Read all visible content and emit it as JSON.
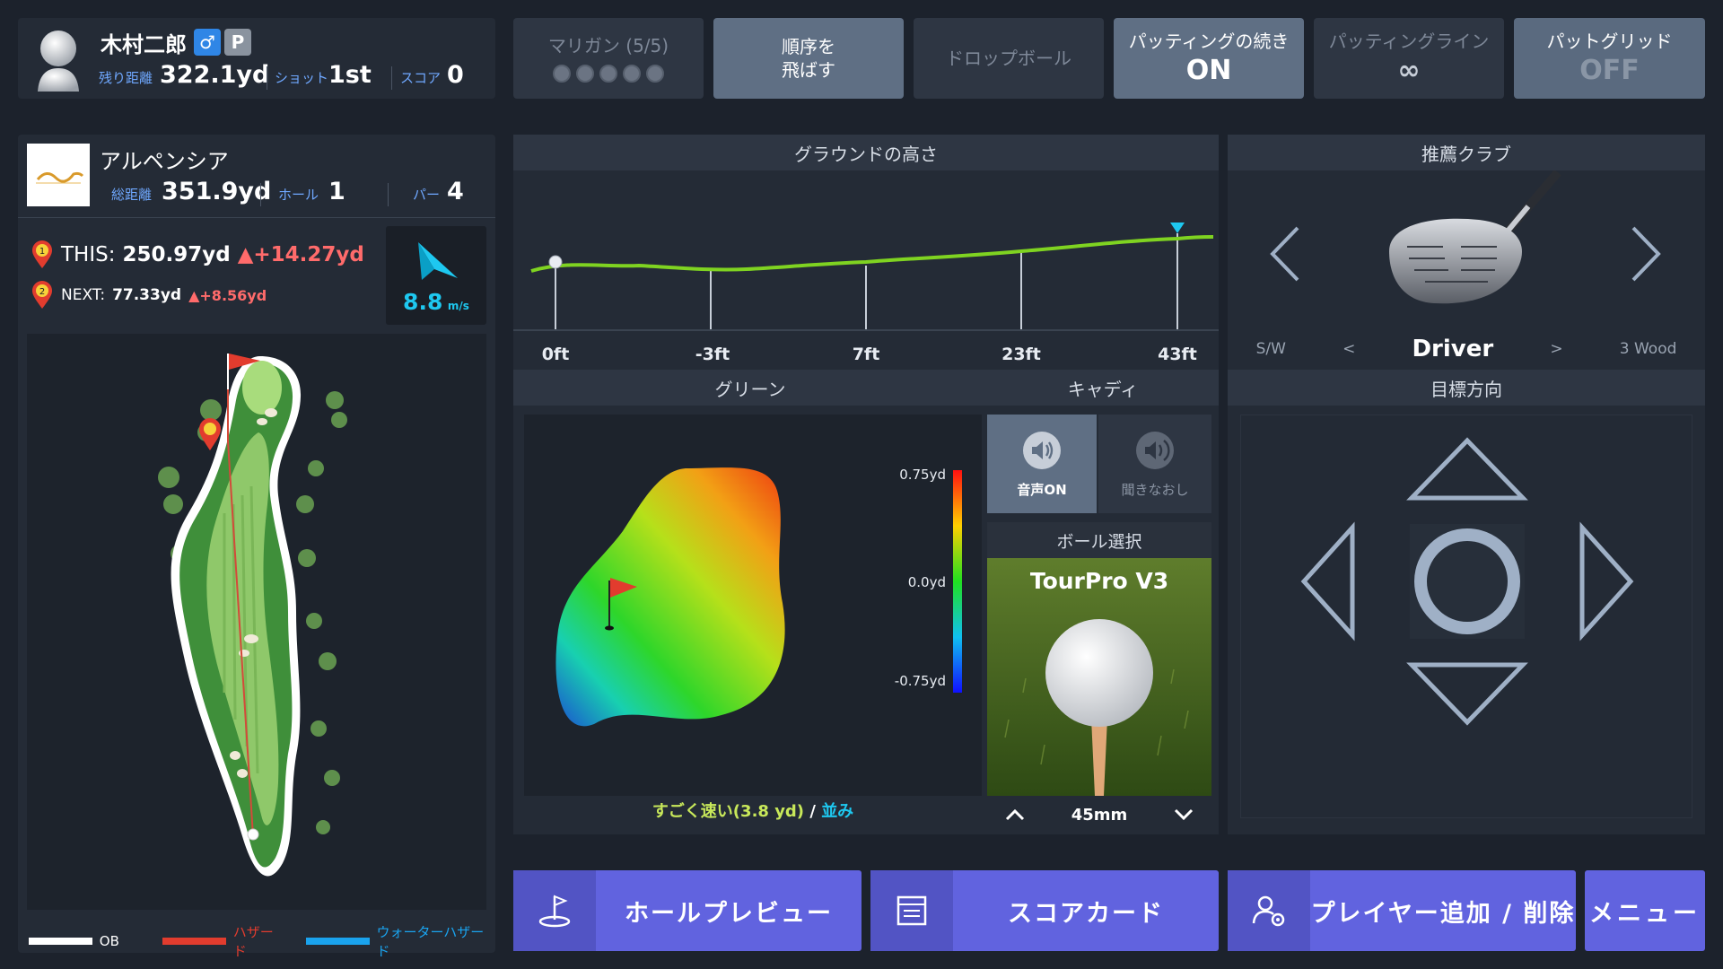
{
  "player": {
    "name": "木村二郎",
    "badge_gender": "♂",
    "badge_p": "P",
    "remaining_label": "残り距離",
    "remaining_value": "322.1yd",
    "shot_label": "ショット",
    "shot_value": "1st",
    "score_label": "スコア",
    "score_value": "0"
  },
  "top_buttons": {
    "mulligan_label": "マリガン (5/5)",
    "skip_line1": "順序を",
    "skip_line2": "飛ばす",
    "drop_label": "ドロップボール",
    "putting_cont_label": "パッティングの続き",
    "putting_cont_value": "ON",
    "putting_line_label": "パッティングライン",
    "putting_line_value": "∞",
    "put_grid_label": "パットグリッド",
    "put_grid_value": "OFF"
  },
  "course": {
    "name": "アルペンシア",
    "total_label": "総距離",
    "total_value": "351.9yd",
    "hole_label": "ホール",
    "hole_value": "1",
    "par_label": "パー",
    "par_value": "4",
    "this_label": "THIS:",
    "this_value": "250.97yd",
    "this_delta": "▲+14.27yd",
    "next_label": "NEXT:",
    "next_value": "77.33yd",
    "next_delta": "▲+8.56yd",
    "wind_value": "8.8",
    "wind_unit": "m/s",
    "marker_1": "1",
    "marker_2": "2",
    "legend_ob": "OB",
    "legend_hazard": "ハザード",
    "legend_water": "ウォーターハザード"
  },
  "ground": {
    "title": "グラウンドの高さ",
    "ticks": [
      "0ft",
      "-3ft",
      "7ft",
      "23ft",
      "43ft"
    ]
  },
  "green": {
    "title": "グリーン",
    "scale_top": "0.75yd",
    "scale_mid": "0.0yd",
    "scale_bottom": "-0.75yd",
    "speed_text": "すごく速い(3.8 yd)",
    "speed_sep": "/",
    "grass_text": "並み"
  },
  "caddie": {
    "title": "キャディ",
    "voice_on": "音声ON",
    "listen_again": "聞きなおし",
    "ball_title": "ボール選択",
    "ball_name": "TourPro V3",
    "tee_height": "45mm"
  },
  "club": {
    "title": "推薦クラブ",
    "prev": "S/W",
    "lt": "<",
    "current": "Driver",
    "gt": ">",
    "next": "3 Wood"
  },
  "aim": {
    "title": "目標方向"
  },
  "bottom": {
    "hole_preview": "ホールプレビュー",
    "scorecard": "スコアカード",
    "player_edit": "プレイヤー追加 / 削除",
    "menu": "メニュー"
  },
  "colors": {
    "accent_blue": "#6fa8ff",
    "delta_red": "#ff6b6b",
    "wind_cyan": "#1ec8f0",
    "speed_yellow": "#c8e85a",
    "bottom_button": "#6163df"
  }
}
